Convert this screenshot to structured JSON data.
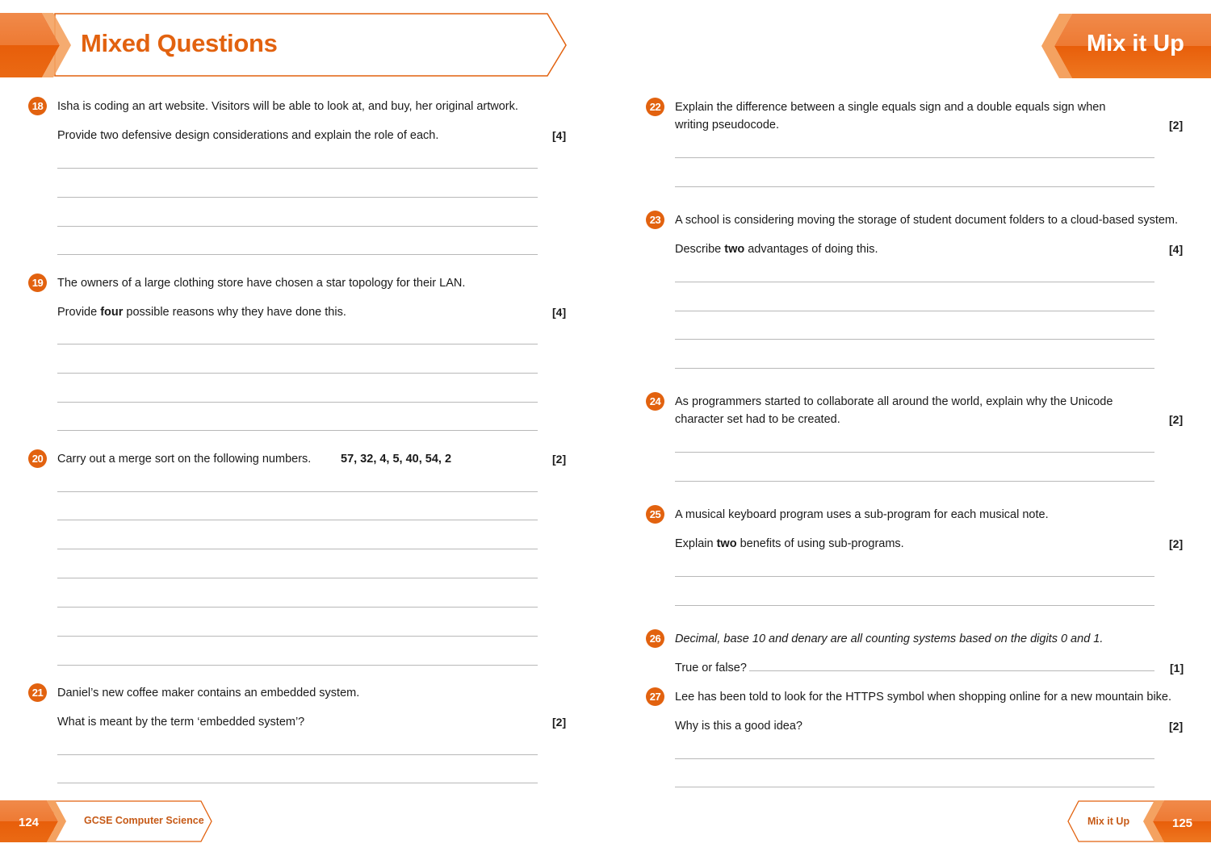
{
  "header": {
    "left_title": "Mixed Questions",
    "right_title": "Mix it Up"
  },
  "footer": {
    "left_page": "124",
    "book_title": "GCSE Computer Science",
    "section": "Mix it Up",
    "right_page": "125"
  },
  "colors": {
    "accent": "#e2620f",
    "accent_light": "#f39a55",
    "answer_line": "#b8b8b8"
  },
  "questions": [
    {
      "number": "18",
      "stem": "Isha is coding an art website. Visitors will be able to look at, and buy, her original artwork.",
      "prompt": "Provide two defensive design considerations and explain the role of each.",
      "marks": "[4]",
      "answer_lines": 4
    },
    {
      "number": "19",
      "stem": "The owners of a large clothing store have chosen a star topology for their LAN.",
      "prompt_pre": "Provide ",
      "prompt_bold": "four",
      "prompt_post": " possible reasons why they have done this.",
      "marks": "[4]",
      "answer_lines": 4
    },
    {
      "number": "20",
      "stem": "Carry out a merge sort on the following numbers.",
      "numbers": "57, 32, 4, 5, 40, 54, 2",
      "marks": "[2]",
      "answer_lines": 7
    },
    {
      "number": "21",
      "stem": "Daniel’s new coffee maker contains an embedded system.",
      "prompt": "What is meant by the term ‘embedded system’?",
      "marks": "[2]",
      "answer_lines": 2
    },
    {
      "number": "22",
      "stem_line1": "Explain the difference between a single equals sign and a double equals sign when",
      "stem_line2": "writing pseudocode.",
      "marks": "[2]",
      "answer_lines": 2
    },
    {
      "number": "23",
      "stem": "A school is considering moving the storage of student document folders to a cloud-based system.",
      "prompt_pre": "Describe ",
      "prompt_bold": "two",
      "prompt_post": " advantages of doing this.",
      "marks": "[4]",
      "answer_lines": 4
    },
    {
      "number": "24",
      "stem_line1": "As programmers started to collaborate all around the world, explain why the Unicode",
      "stem_line2": "character set had to be created.",
      "marks": "[2]",
      "answer_lines": 2
    },
    {
      "number": "25",
      "stem": "A musical keyboard program uses a sub-program for each musical note.",
      "prompt_pre": "Explain ",
      "prompt_bold": "two",
      "prompt_post": " benefits of using sub-programs.",
      "marks": "[2]",
      "answer_lines": 2
    },
    {
      "number": "26",
      "stem": "Decimal, base 10 and denary are all counting systems based on the digits 0 and 1.",
      "prompt": "True or false?",
      "marks": "[1]",
      "answer_lines": 1
    },
    {
      "number": "27",
      "stem": "Lee has been told to look for the HTTPS symbol when shopping online for a new mountain bike.",
      "prompt": "Why is this a good idea?",
      "marks": "[2]",
      "answer_lines": 2
    }
  ]
}
